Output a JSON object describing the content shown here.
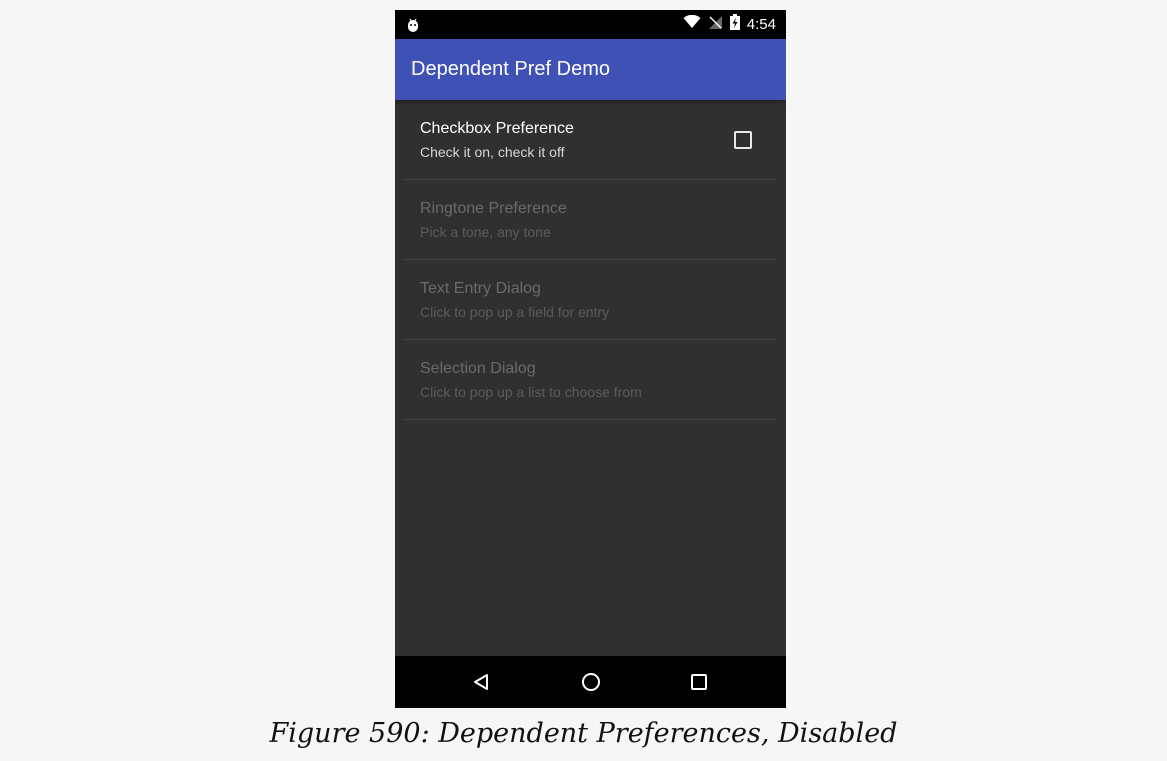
{
  "status_bar": {
    "time": "4:54",
    "icons": [
      "android-debug-icon",
      "wifi-icon",
      "signal-off-icon",
      "battery-charging-icon"
    ]
  },
  "app_bar": {
    "title": "Dependent Pref Demo",
    "color": "#3f51b5"
  },
  "preferences": [
    {
      "title": "Checkbox Preference",
      "summary": "Check it on, check it off",
      "enabled": true,
      "checked": false
    },
    {
      "title": "Ringtone Preference",
      "summary": "Pick a tone, any tone",
      "enabled": false
    },
    {
      "title": "Text Entry Dialog",
      "summary": "Click to pop up a field for entry",
      "enabled": false
    },
    {
      "title": "Selection Dialog",
      "summary": "Click to pop up a list to choose from",
      "enabled": false
    }
  ],
  "nav_bar": {
    "icons": [
      "back-icon",
      "home-icon",
      "recents-icon"
    ]
  },
  "caption": "Figure 590: Dependent Preferences, Disabled"
}
